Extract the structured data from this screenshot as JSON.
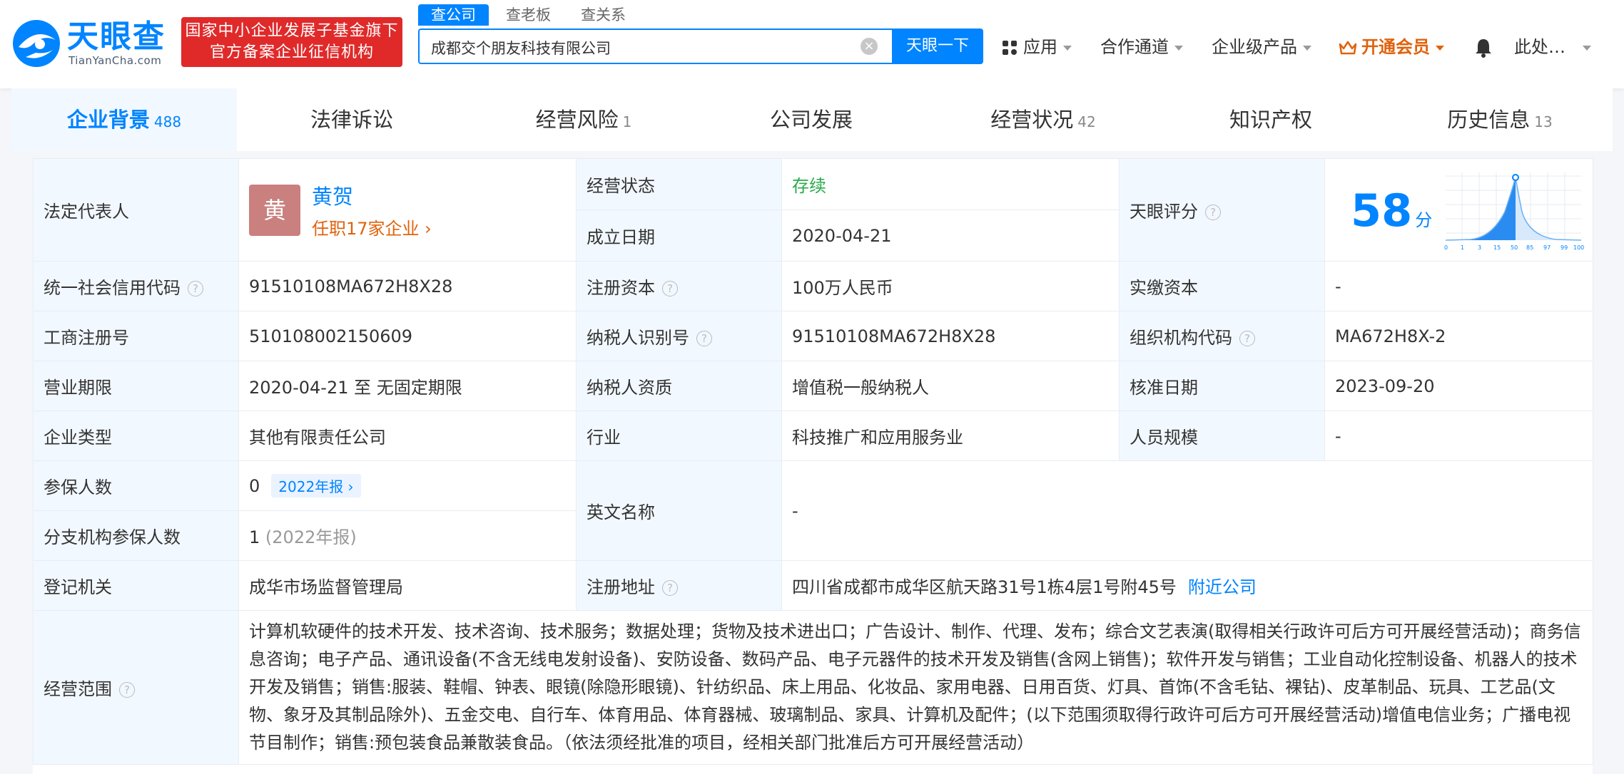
{
  "header": {
    "logo_cn": "天眼查",
    "logo_en": "TianYanCha.com",
    "gov_badge_line1": "国家中小企业发展子基金旗下",
    "gov_badge_line2": "官方备案企业征信机构",
    "search_tabs": [
      "查公司",
      "查老板",
      "查关系"
    ],
    "search_value": "成都交个朋友科技有限公司",
    "search_button": "天眼一下",
    "nav_apps": "应用",
    "nav_partner": "合作通道",
    "nav_enterprise": "企业级产品",
    "nav_vip": "开通会员",
    "nav_user": "此处…"
  },
  "categories": [
    {
      "label": "企业背景",
      "count": "488"
    },
    {
      "label": "法律诉讼",
      "count": ""
    },
    {
      "label": "经营风险",
      "count": "1"
    },
    {
      "label": "公司发展",
      "count": ""
    },
    {
      "label": "经营状况",
      "count": "42"
    },
    {
      "label": "知识产权",
      "count": ""
    },
    {
      "label": "历史信息",
      "count": "13"
    }
  ],
  "info": {
    "legal_rep_label": "法定代表人",
    "legal_rep_avatar": "黄",
    "legal_rep_name": "黄贺",
    "legal_rep_roles": "任职17家企业",
    "status_label": "经营状态",
    "status_value": "存续",
    "established_label": "成立日期",
    "established_value": "2020-04-21",
    "score_label": "天眼评分",
    "score_value": "58",
    "score_unit": "分",
    "score_axis": [
      "0",
      "1",
      "3",
      "15",
      "50",
      "85",
      "97",
      "99",
      "100"
    ],
    "credit_code_label": "统一社会信用代码",
    "credit_code_value": "91510108MA672H8X28",
    "reg_capital_label": "注册资本",
    "reg_capital_value": "100万人民币",
    "paid_capital_label": "实缴资本",
    "paid_capital_value": "-",
    "biz_reg_no_label": "工商注册号",
    "biz_reg_no_value": "510108002150609",
    "taxpayer_id_label": "纳税人识别号",
    "taxpayer_id_value": "91510108MA672H8X28",
    "org_code_label": "组织机构代码",
    "org_code_value": "MA672H8X-2",
    "term_label": "营业期限",
    "term_value": "2020-04-21 至 无固定期限",
    "taxpayer_qual_label": "纳税人资质",
    "taxpayer_qual_value": "增值税一般纳税人",
    "approval_date_label": "核准日期",
    "approval_date_value": "2023-09-20",
    "company_type_label": "企业类型",
    "company_type_value": "其他有限责任公司",
    "industry_label": "行业",
    "industry_value": "科技推广和应用服务业",
    "staff_size_label": "人员规模",
    "staff_size_value": "-",
    "insured_label": "参保人数",
    "insured_value": "0",
    "insured_report": "2022年报",
    "english_name_label": "英文名称",
    "english_name_value": "-",
    "branch_insured_label": "分支机构参保人数",
    "branch_insured_value": "1",
    "branch_insured_note": "(2022年报)",
    "registrar_label": "登记机关",
    "registrar_value": "成华市场监督管理局",
    "address_label": "注册地址",
    "address_value": "四川省成都市成华区航天路31号1栋4层1号附45号",
    "address_link": "附近公司",
    "scope_label": "经营范围",
    "scope_value": "计算机软硬件的技术开发、技术咨询、技术服务；数据处理；货物及技术进出口；广告设计、制作、代理、发布；综合文艺表演(取得相关行政许可后方可开展经营活动)；商务信息咨询；电子产品、通讯设备(不含无线电发射设备)、安防设备、数码产品、电子元器件的技术开发及销售(含网上销售)；软件开发与销售；工业自动化控制设备、机器人的技术开发及销售；销售:服装、鞋帽、钟表、眼镜(除隐形眼镜)、针纺织品、床上用品、化妆品、家用电器、日用百货、灯具、首饰(不含毛钻、裸钻)、皮革制品、玩具、工艺品(文物、象牙及其制品除外)、五金交电、自行车、体育用品、体育器械、玻璃制品、家具、计算机及配件；(以下范围须取得行政许可后方可开展经营活动)增值电信业务；广播电视节目制作；销售:预包装食品兼散装食品。（依法须经批准的项目，经相关部门批准后方可开展经营活动）"
  },
  "colors": {
    "brand": "#0084ff",
    "vip": "#e0620c",
    "badge": "#e02a2a",
    "status_ok": "#2aaa4a"
  }
}
